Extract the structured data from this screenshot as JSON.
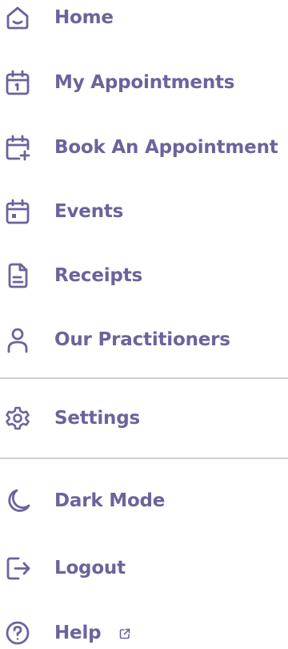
{
  "menu": {
    "items": [
      {
        "label": "Home",
        "icon": "home-icon"
      },
      {
        "label": "My Appointments",
        "icon": "calendar-one-icon"
      },
      {
        "label": "Book An Appointment",
        "icon": "calendar-plus-icon"
      },
      {
        "label": "Events",
        "icon": "calendar-event-icon"
      },
      {
        "label": "Receipts",
        "icon": "receipt-icon"
      },
      {
        "label": "Our Practitioners",
        "icon": "user-icon"
      }
    ],
    "settings": {
      "label": "Settings",
      "icon": "gear-icon"
    },
    "dark_mode": {
      "label": "Dark Mode",
      "icon": "moon-icon"
    },
    "logout": {
      "label": "Logout",
      "icon": "logout-icon"
    },
    "help": {
      "label": "Help",
      "icon": "help-icon",
      "external_icon": "external-link-icon"
    }
  },
  "colors": {
    "accent": "#6a649c",
    "divider": "#d0d0d0",
    "background": "#ffffff"
  }
}
